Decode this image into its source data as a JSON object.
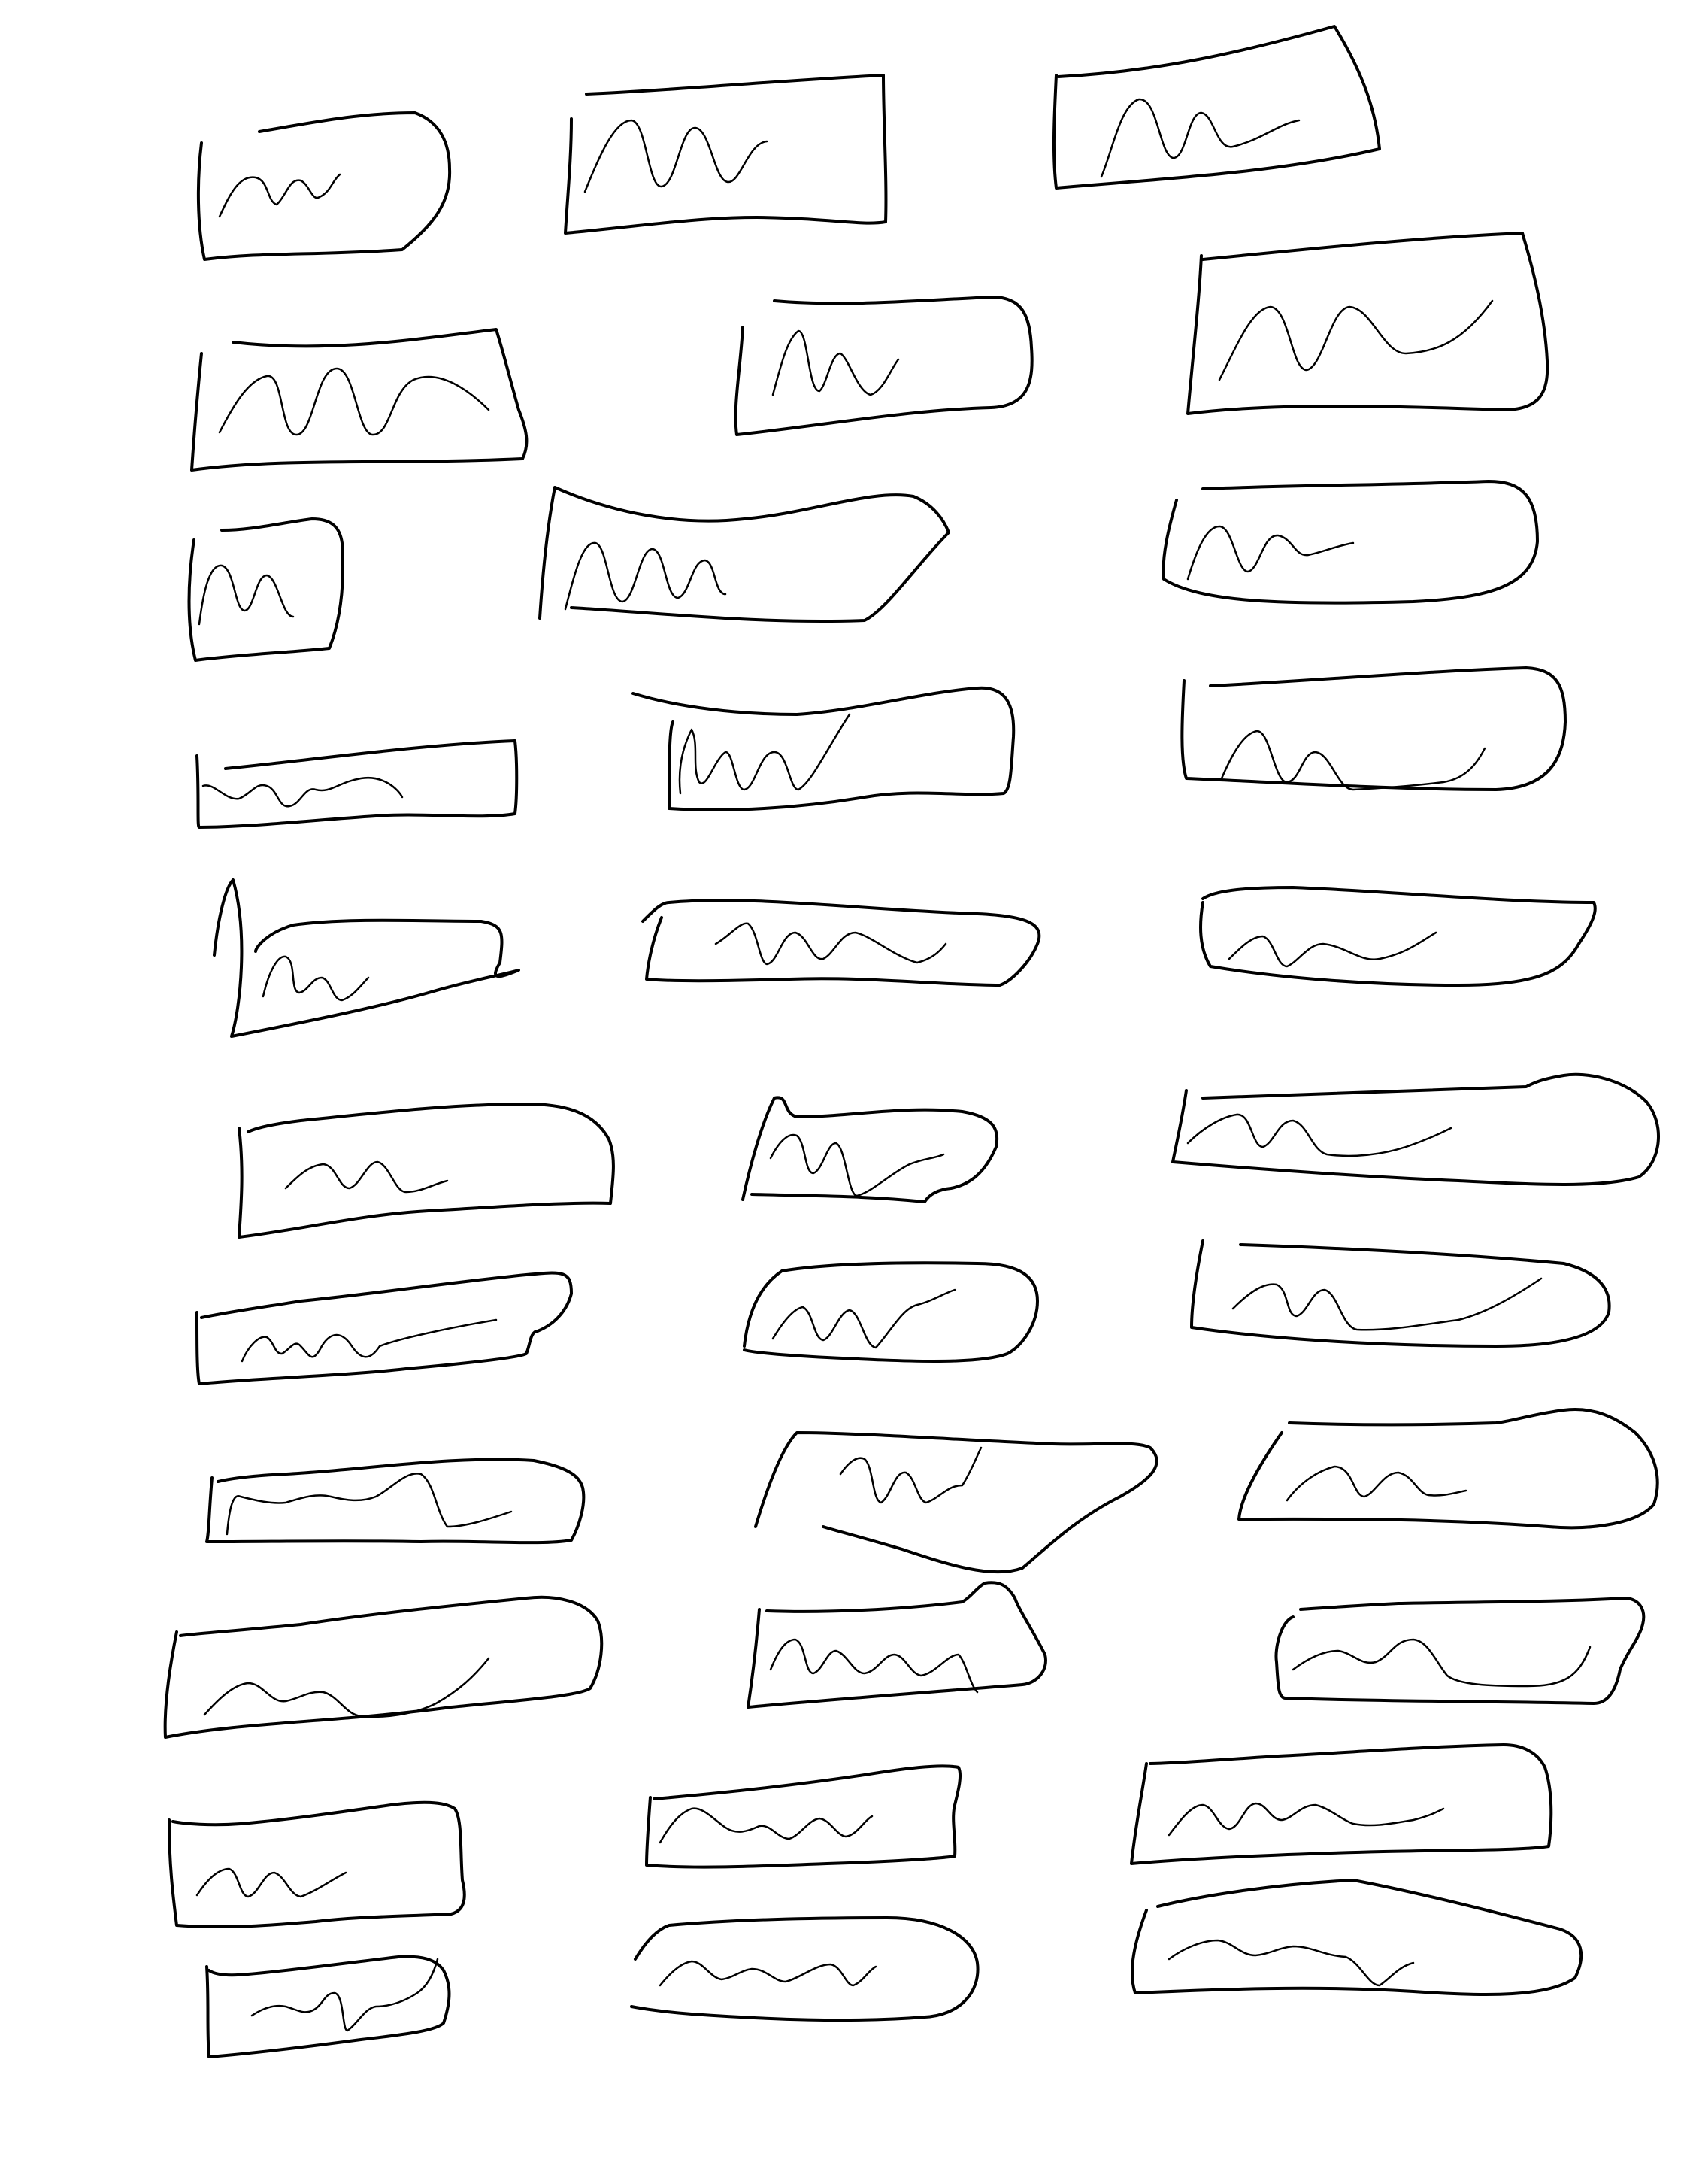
{
  "canvas": {
    "background_color": "#ffffff",
    "stroke_color": "#000000"
  },
  "sketches": {
    "count": 34
  }
}
